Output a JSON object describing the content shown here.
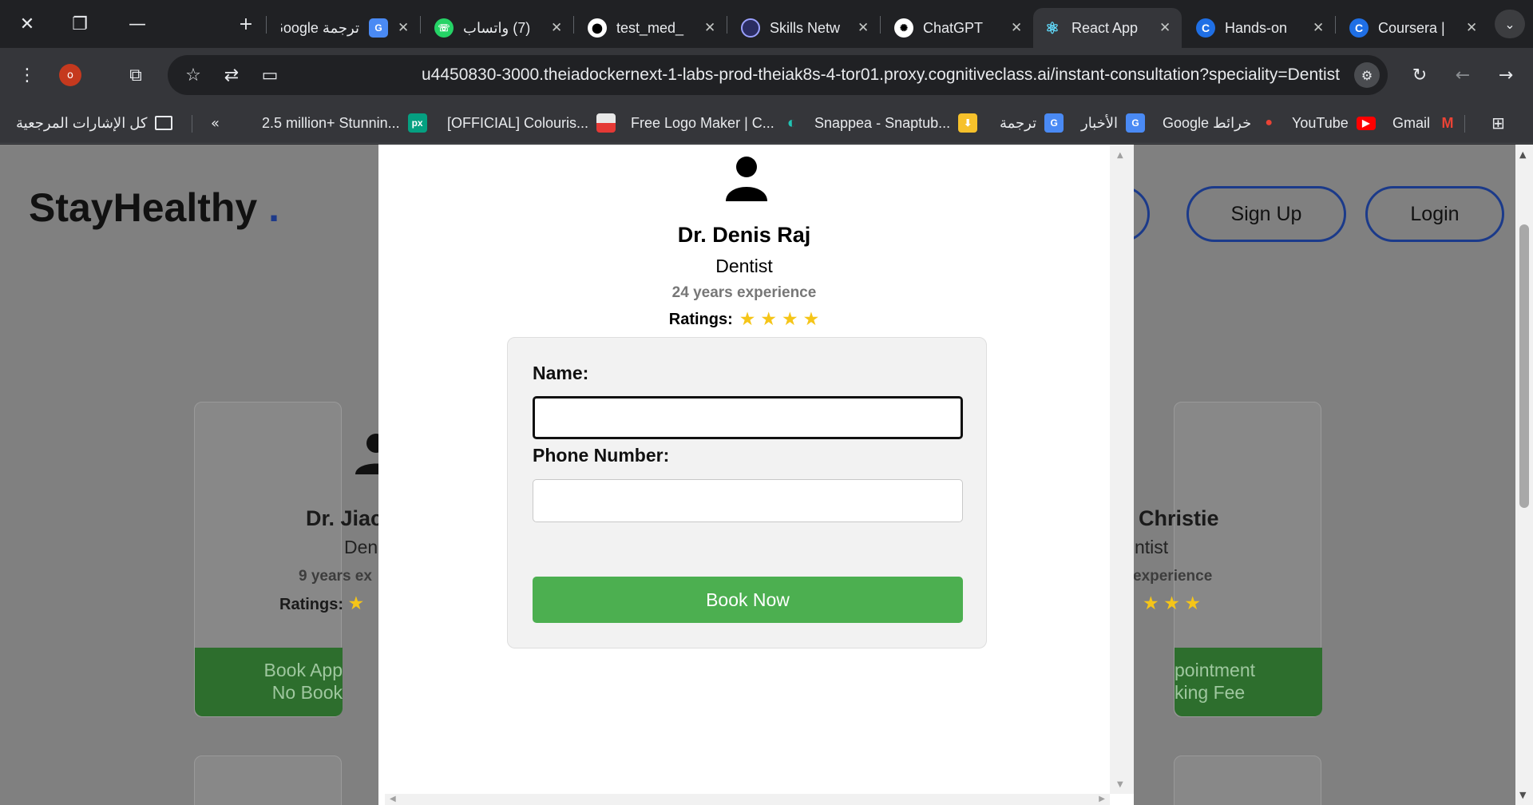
{
  "tabs": [
    {
      "title": "ترجمة Google",
      "icon": "google-translate-icon",
      "favicon_text": "G"
    },
    {
      "title": "(7) واتساب",
      "icon": "whatsapp-icon",
      "favicon_text": "☏"
    },
    {
      "title": "test_med_",
      "icon": "github-icon",
      "favicon_text": "⬤"
    },
    {
      "title": "Skills Netw",
      "icon": "skills-network-icon",
      "favicon_text": ""
    },
    {
      "title": "ChatGPT",
      "icon": "chatgpt-icon",
      "favicon_text": "✺"
    },
    {
      "title": "React App",
      "icon": "react-icon",
      "favicon_text": "⚛"
    },
    {
      "title": "Hands-on",
      "icon": "coursera-icon",
      "favicon_text": "C"
    },
    {
      "title": "Coursera |",
      "icon": "coursera-icon",
      "favicon_text": "C"
    }
  ],
  "active_tab_index": 5,
  "profile_initial": "o",
  "address_bar": {
    "url": "u4450830-3000.theiadockernext-1-labs-prod-theiak8s-4-tor01.proxy.cognitiveclass.ai/instant-consultation?speciality=Dentist"
  },
  "bookmarks": [
    {
      "label": "كل الإشارات المرجعية",
      "icon": "folder-icon"
    },
    {
      "label": "2.5 million+ Stunnin...",
      "icon": "pexels-icon",
      "favicon_text": "px",
      "color": "#05a081"
    },
    {
      "label": "[OFFICIAL] Colouris...",
      "icon": "colourise-icon",
      "favicon_text": "",
      "color": "#e8e8e8"
    },
    {
      "label": "Free Logo Maker | C...",
      "icon": "logo-maker-icon",
      "favicon_text": "◐",
      "color": "#20c4b4"
    },
    {
      "label": "Snappea - Snaptub...",
      "icon": "snappea-icon",
      "favicon_text": "⬇",
      "color": "#f6c12b"
    },
    {
      "label": "ترجمة",
      "icon": "google-translate-icon",
      "favicon_text": "G",
      "color": "#4a8af4"
    },
    {
      "label": "الأخبار",
      "icon": "google-news-icon",
      "favicon_text": "G",
      "color": "#4a8af4"
    },
    {
      "label": "Google خرائط",
      "icon": "google-maps-icon",
      "favicon_text": "📍",
      "color": "transparent"
    },
    {
      "label": "YouTube",
      "icon": "youtube-icon",
      "favicon_text": "▶",
      "color": "#ff0000"
    },
    {
      "label": "Gmail",
      "icon": "gmail-icon",
      "favicon_text": "M",
      "color": "transparent"
    }
  ],
  "site": {
    "logo_text": "StayHealthy",
    "logo_dot": ".",
    "signup_label": "Sign Up",
    "login_label": "Login"
  },
  "background_cards": [
    {
      "name_visible": "Dr. Jiac",
      "speciality_visible": "Den",
      "experience_visible": "9 years ex",
      "ratings_label": "Ratings:",
      "book_line1": "Book App",
      "book_line2": "No Book"
    },
    {
      "name_visible": "Christie",
      "speciality_visible": "ntist",
      "experience_visible": "experience",
      "book_line1": "pointment",
      "book_line2": "king Fee"
    }
  ],
  "modal": {
    "doctor_name": "Dr. Denis Raj",
    "speciality": "Dentist",
    "experience": "24 years experience",
    "ratings_label": "Ratings:",
    "rating_stars": 4,
    "form": {
      "name_label": "Name:",
      "name_value": "",
      "phone_label": "Phone Number:",
      "phone_value": "",
      "submit_label": "Book Now"
    }
  },
  "colors": {
    "book_button": "#4caf50",
    "brand_blue": "#1e3a8a",
    "star": "#f5c518",
    "overlay_gray": "#808080"
  }
}
